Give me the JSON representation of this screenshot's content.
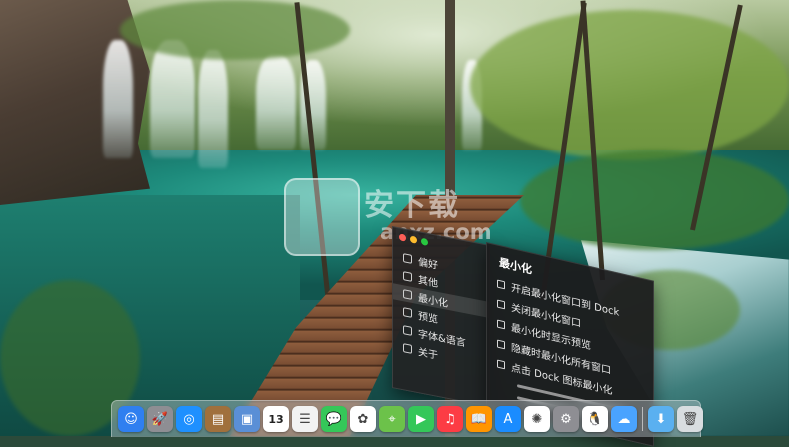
{
  "wallpaper": {
    "watermark_title": "安下载",
    "watermark_sub": "anxz.com"
  },
  "menu": {
    "left_items": [
      {
        "label": "偏好",
        "icon": "preferences-icon"
      },
      {
        "label": "其他",
        "icon": "other-icon"
      },
      {
        "label": "最小化",
        "icon": "minimize-icon",
        "selected": true
      },
      {
        "label": "预览",
        "icon": "preview-icon"
      },
      {
        "label": "字体&语言",
        "icon": "font-language-icon"
      },
      {
        "label": "关于",
        "icon": "about-icon"
      }
    ],
    "right_panel": {
      "title": "最小化",
      "options": [
        {
          "label": "开启最小化窗口到 Dock"
        },
        {
          "label": "关闭最小化窗口"
        },
        {
          "label": "最小化时显示预览"
        },
        {
          "label": "隐藏时最小化所有窗口"
        },
        {
          "label": "点击 Dock 图标最小化"
        }
      ]
    },
    "traffic_colors": [
      "#ff5f57",
      "#febc2e",
      "#28c840"
    ]
  },
  "dock": {
    "apps": [
      {
        "name": "finder-icon",
        "glyph": "☺",
        "color": "#2f7ff0"
      },
      {
        "name": "launchpad-icon",
        "glyph": "🚀",
        "color": "#8e8e93"
      },
      {
        "name": "safari-icon",
        "glyph": "◎",
        "color": "#1e90ff"
      },
      {
        "name": "notes-book-icon",
        "glyph": "▤",
        "color": "#a0703c"
      },
      {
        "name": "photo-preview-icon",
        "glyph": "▣",
        "color": "#5a8fd6"
      },
      {
        "name": "calendar-icon",
        "glyph": "13",
        "color": "#ffffff"
      },
      {
        "name": "reminders-icon",
        "glyph": "☰",
        "color": "#f2f2f2"
      },
      {
        "name": "messages-icon",
        "glyph": "💬",
        "color": "#35c759"
      },
      {
        "name": "photos-icon",
        "glyph": "✿",
        "color": "#ffffff"
      },
      {
        "name": "maps-icon",
        "glyph": "⌖",
        "color": "#6cc24a"
      },
      {
        "name": "facetime-icon",
        "glyph": "▶",
        "color": "#34c759"
      },
      {
        "name": "music-icon",
        "glyph": "♫",
        "color": "#fc3c44"
      },
      {
        "name": "books-icon",
        "glyph": "📖",
        "color": "#ff9500"
      },
      {
        "name": "app-store-icon",
        "glyph": "A",
        "color": "#1a8cff"
      },
      {
        "name": "pinwheel-icon",
        "glyph": "✺",
        "color": "#ffffff"
      },
      {
        "name": "system-preferences-icon",
        "glyph": "⚙",
        "color": "#8e8e93"
      },
      {
        "name": "qq-penguin-icon",
        "glyph": "🐧",
        "color": "#ffffff"
      },
      {
        "name": "weather-cloud-icon",
        "glyph": "☁",
        "color": "#4aa3ff"
      },
      {
        "name": "downloads-folder-icon",
        "glyph": "⬇",
        "color": "#5ab0f0"
      },
      {
        "name": "trash-icon",
        "glyph": "🗑",
        "color": "#d8dde0"
      }
    ]
  }
}
